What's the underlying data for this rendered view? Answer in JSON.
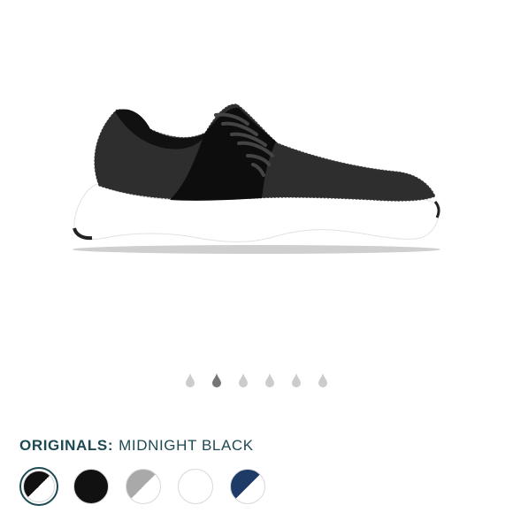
{
  "product": {
    "collection": "ORIGINALS:",
    "color_name": "MIDNIGHT BLACK",
    "image_icon": "sneaker-side-view-image"
  },
  "gallery": {
    "dots": 6,
    "active_index": 1,
    "active_color": "#777777",
    "inactive_color": "#cccccc"
  },
  "swatches": [
    {
      "name": "black-white-split",
      "colors": [
        "#111111",
        "#ffffff"
      ],
      "selected": true
    },
    {
      "name": "black",
      "colors": [
        "#111111",
        "#111111"
      ],
      "selected": false
    },
    {
      "name": "grey-white-split",
      "colors": [
        "#a9a9a9",
        "#ffffff"
      ],
      "selected": false
    },
    {
      "name": "white",
      "colors": [
        "#ffffff",
        "#ffffff"
      ],
      "selected": false
    },
    {
      "name": "navy-white-split",
      "colors": [
        "#1e3a66",
        "#ffffff"
      ],
      "selected": false
    }
  ],
  "colors": {
    "title": "#1d4a52",
    "selected_ring": "#1d4a52"
  }
}
